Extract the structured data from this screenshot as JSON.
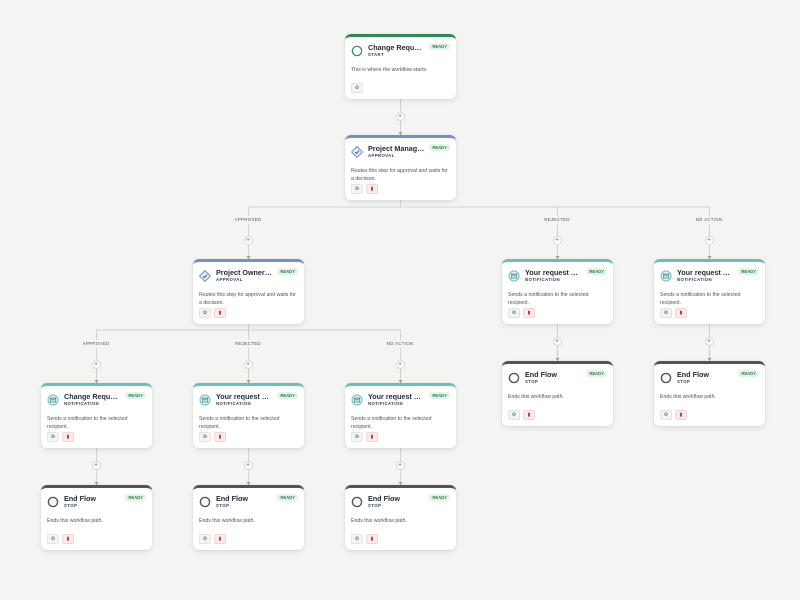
{
  "colors": {
    "background": "#f4f5f3",
    "start": "#2e8b57",
    "approval": "#6f93c8",
    "notification": "#6cbdbd",
    "stop": "#4b5563",
    "ready_badge_bg": "#e3f3e8",
    "ready_badge_text": "#2e7d4f",
    "delete": "#c53030"
  },
  "badge_label": "READY",
  "nodes": [
    {
      "title": "Change Request",
      "kind": "START",
      "type": "start",
      "icon": "circle-outline-icon",
      "description": "This is where the workflow starts.",
      "actions": [
        "settings"
      ]
    },
    {
      "title": "Project Manager's Approval",
      "kind": "APPROVAL",
      "type": "approval",
      "icon": "approval-diamond-icon",
      "description": "Routes this step for approval and waits for a decision.",
      "actions": [
        "settings",
        "delete"
      ]
    },
    {
      "title": "Project Owner's Approval",
      "kind": "APPROVAL",
      "type": "approval",
      "icon": "approval-diamond-icon",
      "description": "Routes this step for approval and waits for a decision.",
      "actions": [
        "settings",
        "delete"
      ]
    },
    {
      "title": "Your request has been rejected",
      "kind": "NOTIFICATION",
      "type": "notification",
      "icon": "mail-icon",
      "description": "Sends a notification to the selected recipient.",
      "actions": [
        "settings",
        "delete"
      ]
    },
    {
      "title": "Your request has no action",
      "kind": "NOTIFICATION",
      "type": "notification",
      "icon": "mail-icon",
      "description": "Sends a notification to the selected recipient.",
      "actions": [
        "settings",
        "delete"
      ]
    },
    {
      "title": "Change Request Approved",
      "kind": "NOTIFICATION",
      "type": "notification",
      "icon": "mail-icon",
      "description": "Sends a notification to the selected recipient.",
      "actions": [
        "settings",
        "delete"
      ]
    },
    {
      "title": "Your request has been rejected",
      "kind": "NOTIFICATION",
      "type": "notification",
      "icon": "mail-icon",
      "description": "Sends a notification to the selected recipient.",
      "actions": [
        "settings",
        "delete"
      ]
    },
    {
      "title": "Your request has no action",
      "kind": "NOTIFICATION",
      "type": "notification",
      "icon": "mail-icon",
      "description": "Sends a notification to the selected recipient.",
      "actions": [
        "settings",
        "delete"
      ]
    },
    {
      "title": "End Flow",
      "kind": "STOP",
      "type": "stop",
      "icon": "stop-circle-icon",
      "description": "Ends this workflow path.",
      "actions": [
        "settings",
        "delete"
      ]
    },
    {
      "title": "End Flow",
      "kind": "STOP",
      "type": "stop",
      "icon": "stop-circle-icon",
      "description": "Ends this workflow path.",
      "actions": [
        "settings",
        "delete"
      ]
    },
    {
      "title": "End Flow",
      "kind": "STOP",
      "type": "stop",
      "icon": "stop-circle-icon",
      "description": "Ends this workflow path.",
      "actions": [
        "settings",
        "delete"
      ]
    },
    {
      "title": "End Flow",
      "kind": "STOP",
      "type": "stop",
      "icon": "stop-circle-icon",
      "description": "Ends this workflow path.",
      "actions": [
        "settings",
        "delete"
      ]
    },
    {
      "title": "End Flow",
      "kind": "STOP",
      "type": "stop",
      "icon": "stop-circle-icon",
      "description": "Ends this workflow path.",
      "actions": [
        "settings",
        "delete"
      ]
    }
  ],
  "edge_labels": [
    "APPROVED",
    "REJECTED",
    "NO ACTION",
    "APPROVED",
    "REJECTED",
    "NO ACTION"
  ],
  "add_step_label": "+"
}
